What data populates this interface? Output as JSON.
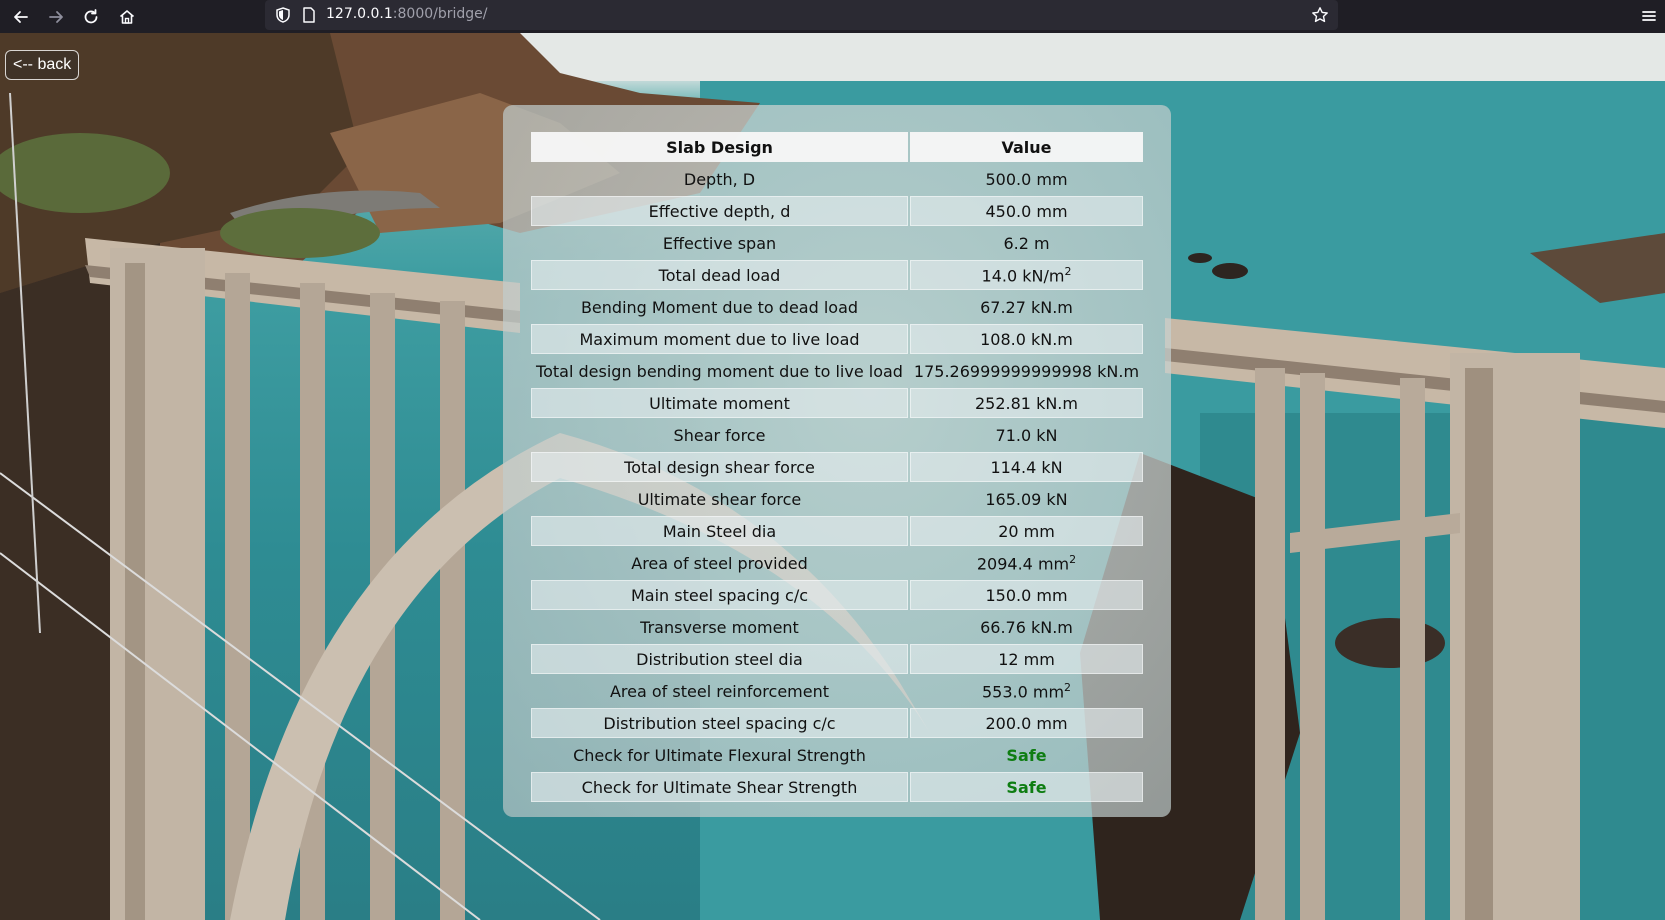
{
  "browser": {
    "url_host": "127.0.0.1",
    "url_rest": ":8000/bridge/"
  },
  "page": {
    "back_label": "<-- back",
    "table": {
      "headers": [
        "Slab Design",
        "Value"
      ],
      "rows": [
        {
          "label": "Depth, D",
          "value": "500.0 mm"
        },
        {
          "label": "Effective depth, d",
          "value": "450.0 mm"
        },
        {
          "label": "Effective span",
          "value": "6.2 m"
        },
        {
          "label": "Total dead load",
          "value": "14.0 kN/m",
          "sup": "2"
        },
        {
          "label": "Bending Moment due to dead load",
          "value": "67.27 kN.m"
        },
        {
          "label": "Maximum moment due to live load",
          "value": "108.0 kN.m"
        },
        {
          "label": "Total design bending moment due to live load",
          "value": "175.26999999999998 kN.m"
        },
        {
          "label": "Ultimate moment",
          "value": "252.81 kN.m"
        },
        {
          "label": "Shear force",
          "value": "71.0 kN"
        },
        {
          "label": "Total design shear force",
          "value": "114.4 kN"
        },
        {
          "label": "Ultimate shear force",
          "value": "165.09 kN"
        },
        {
          "label": "Main Steel dia",
          "value": "20 mm"
        },
        {
          "label": "Area of steel provided",
          "value": "2094.4 mm",
          "sup": "2"
        },
        {
          "label": "Main steel spacing c/c",
          "value": "150.0 mm"
        },
        {
          "label": "Transverse moment",
          "value": "66.76 kN.m"
        },
        {
          "label": "Distribution steel dia",
          "value": "12 mm"
        },
        {
          "label": "Area of steel reinforcement",
          "value": "553.0 mm",
          "sup": "2"
        },
        {
          "label": "Distribution steel spacing c/c",
          "value": "200.0 mm"
        },
        {
          "label": "Check for Ultimate Flexural Strength",
          "value": "Safe",
          "status": "safe"
        },
        {
          "label": "Check for Ultimate Shear Strength",
          "value": "Safe",
          "status": "safe"
        }
      ]
    }
  },
  "colors": {
    "safe": "#0e7d12",
    "chrome": "#1f1e25",
    "urlbar": "#2b2a33"
  }
}
